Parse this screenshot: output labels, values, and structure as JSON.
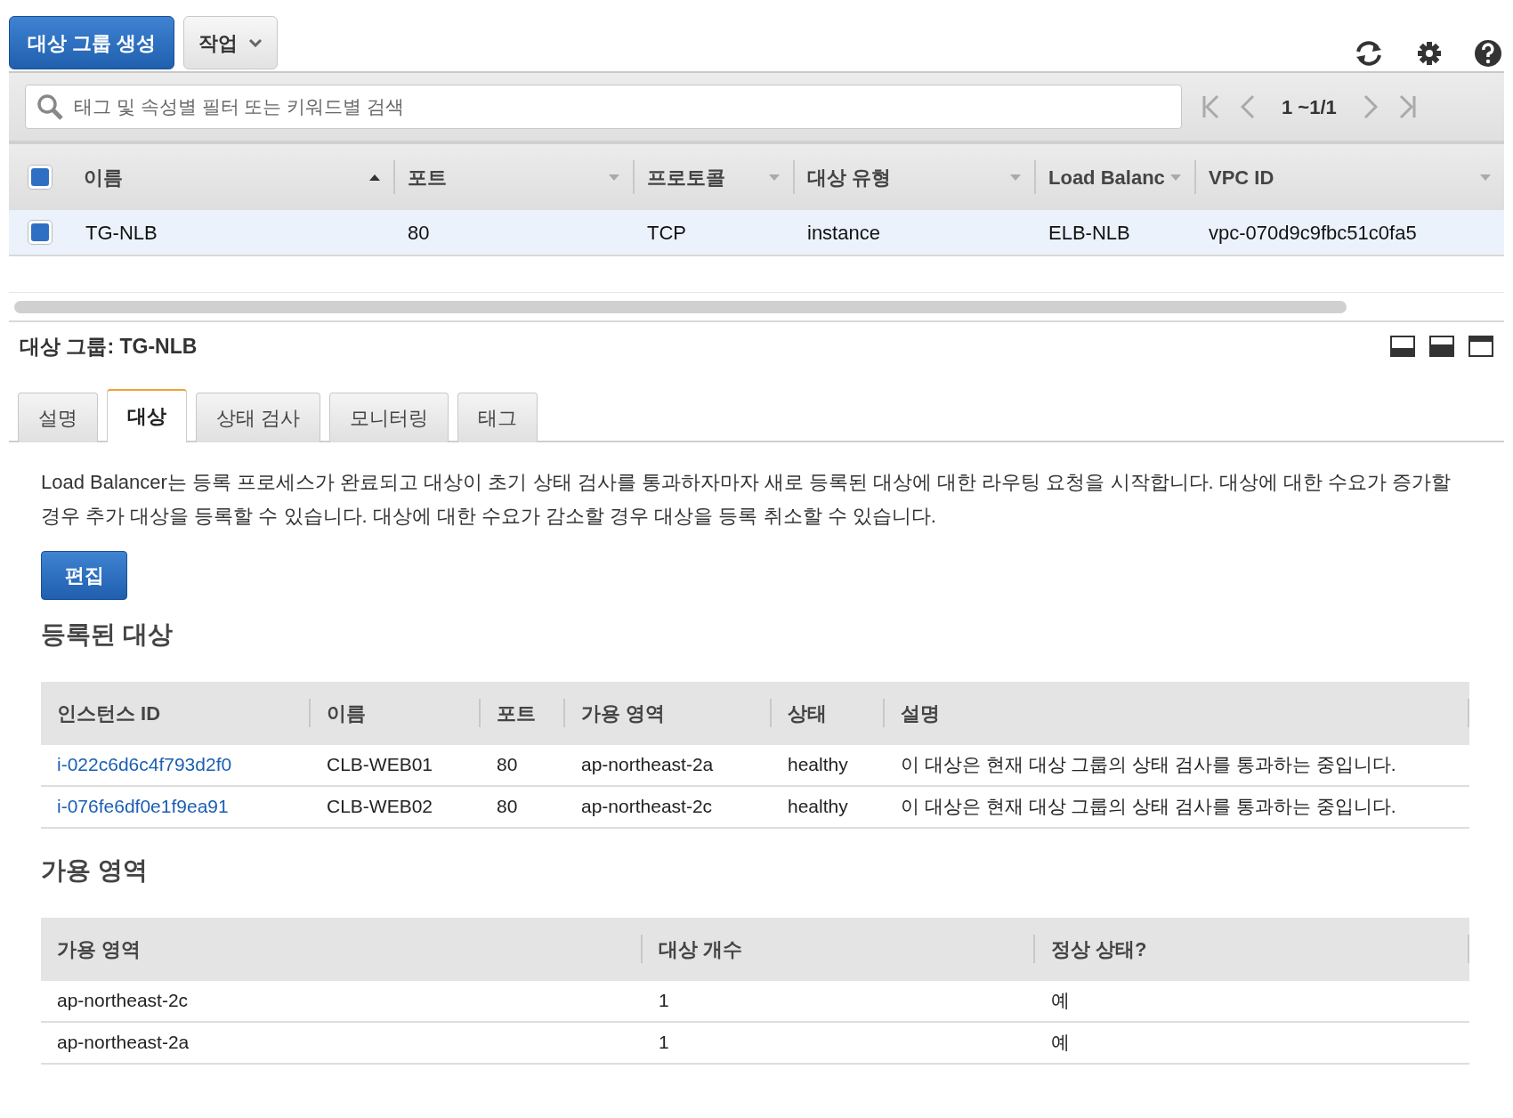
{
  "toolbar": {
    "create_button": "대상 그룹 생성",
    "actions_button": "작업"
  },
  "search": {
    "placeholder": "태그 및 속성별 필터 또는 키워드별 검색"
  },
  "pager": {
    "text": "1 ~1/1"
  },
  "target_groups": {
    "header_checked": true,
    "columns": [
      {
        "label": "이름",
        "sorted": true
      },
      {
        "label": "포트",
        "sorted": false
      },
      {
        "label": "프로토콜",
        "sorted": false
      },
      {
        "label": "대상 유형",
        "sorted": false
      },
      {
        "label": "Load Balanc",
        "sorted": false
      },
      {
        "label": "VPC ID",
        "sorted": false
      }
    ],
    "rows": [
      {
        "checked": true,
        "selected": true,
        "cells": [
          "TG-NLB",
          "80",
          "TCP",
          "instance",
          "ELB-NLB",
          "vpc-070d9c9fbc51c0fa5"
        ]
      }
    ]
  },
  "details": {
    "title": "대상 그룹: TG-NLB",
    "tabs": [
      {
        "label": "설명",
        "selected": false
      },
      {
        "label": "대상",
        "selected": true
      },
      {
        "label": "상태 검사",
        "selected": false
      },
      {
        "label": "모니터링",
        "selected": false
      },
      {
        "label": "태그",
        "selected": false
      }
    ],
    "description": "Load Balancer는 등록 프로세스가 완료되고 대상이 초기 상태 검사를 통과하자마자 새로 등록된 대상에 대한 라우팅 요청을 시작합니다. 대상에 대한 수요가 증가할 경우 추가 대상을 등록할 수 있습니다. 대상에 대한 수요가 감소할 경우 대상을 등록 취소할 수 있습니다.",
    "edit_button": "편집",
    "registered_heading": "등록된 대상",
    "registered_targets": {
      "columns": [
        "인스턴스 ID",
        "이름",
        "포트",
        "가용 영역",
        "상태",
        "설명"
      ],
      "rows": [
        [
          "i-022c6d6c4f793d2f0",
          "CLB-WEB01",
          "80",
          "ap-northeast-2a",
          "healthy",
          "이 대상은 현재 대상 그룹의 상태 검사를 통과하는 중입니다."
        ],
        [
          "i-076fe6df0e1f9ea91",
          "CLB-WEB02",
          "80",
          "ap-northeast-2c",
          "healthy",
          "이 대상은 현재 대상 그룹의 상태 검사를 통과하는 중입니다."
        ]
      ]
    },
    "az_heading": "가용 영역",
    "availability_zones": {
      "columns": [
        "가용 영역",
        "대상 개수",
        "정상 상태?"
      ],
      "rows": [
        [
          "ap-northeast-2c",
          "1",
          "예"
        ],
        [
          "ap-northeast-2a",
          "1",
          "예"
        ]
      ]
    }
  }
}
